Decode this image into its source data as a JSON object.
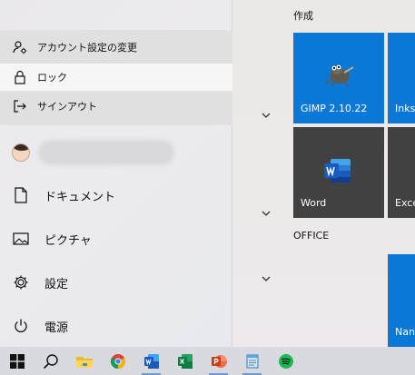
{
  "account_menu": {
    "items": [
      {
        "label": "アカウント設定の変更",
        "icon": "account-settings-icon"
      },
      {
        "label": "ロック",
        "icon": "lock-icon"
      },
      {
        "label": "サインアウト",
        "icon": "sign-out-icon"
      }
    ]
  },
  "nav": {
    "items": [
      {
        "label": "ドキュメント",
        "icon": "document-icon"
      },
      {
        "label": "ピクチャ",
        "icon": "pictures-icon"
      },
      {
        "label": "設定",
        "icon": "gear-icon"
      },
      {
        "label": "電源",
        "icon": "power-icon"
      }
    ]
  },
  "tiles": {
    "group1_title": "作成",
    "group2_title": "OFFICE",
    "gimp": "GIMP 2.10.22",
    "inkscape": "Inks",
    "word": "Word",
    "excel": "Exce",
    "nan": "Nan"
  },
  "colors": {
    "tile_blue": "#0a78d7",
    "tile_dark": "#414141",
    "taskbar": "#d8dadf"
  },
  "taskbar": {
    "icons": [
      "windows-start-icon",
      "search-icon",
      "file-explorer-icon",
      "chrome-icon",
      "word-icon",
      "excel-icon",
      "powerpoint-icon",
      "notepad-icon",
      "spotify-icon"
    ]
  }
}
